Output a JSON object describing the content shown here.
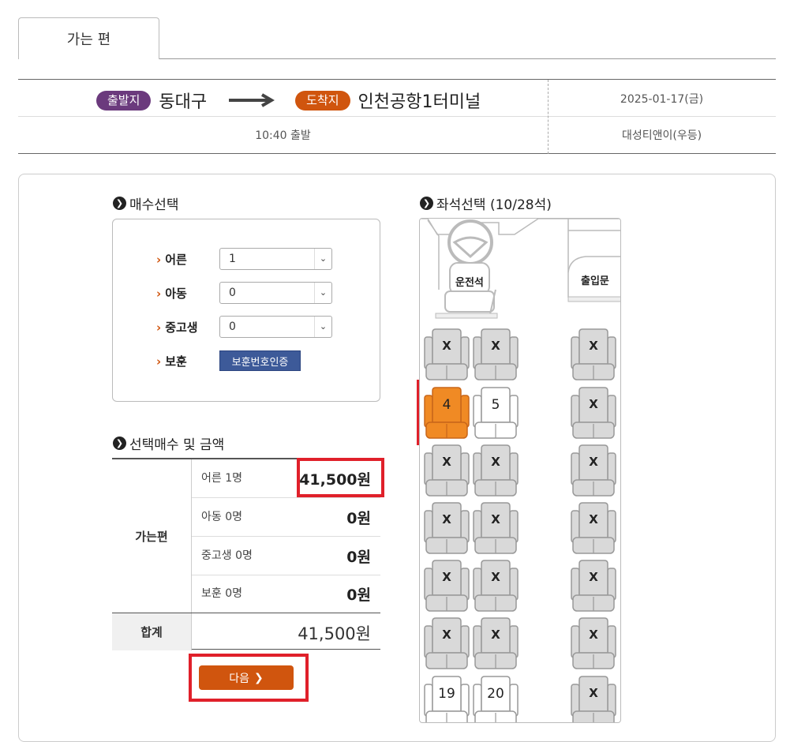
{
  "tab": {
    "label": "가는 편"
  },
  "route": {
    "departure_badge": "출발지",
    "departure_city": "동대구",
    "arrival_badge": "도착지",
    "arrival_city": "인천공항1터미널",
    "date": "2025-01-17(금)",
    "time": "10:40 출발",
    "company": "대성티앤이(우등)"
  },
  "count_section": {
    "title": "매수선택",
    "rows": [
      {
        "label": "어른",
        "value": "1"
      },
      {
        "label": "아동",
        "value": "0"
      },
      {
        "label": "중고생",
        "value": "0"
      },
      {
        "label": "보훈",
        "button": "보훈번호인증"
      }
    ]
  },
  "price_section": {
    "title": "선택매수 및 금액",
    "group": "가는편",
    "rows": [
      {
        "label": "어른 1명",
        "amount": "41,500원"
      },
      {
        "label": "아동 0명",
        "amount": "0원"
      },
      {
        "label": "중고생 0명",
        "amount": "0원"
      },
      {
        "label": "보훈 0명",
        "amount": "0원"
      }
    ],
    "total_label": "합계",
    "total_value": "41,500원",
    "next_button": "다음"
  },
  "seat_section": {
    "title": "좌석선택 (10/28석)",
    "driver_label": "운전석",
    "door_label": "출입문",
    "taken_mark": "X",
    "seats": [
      {
        "label": "X",
        "status": "taken"
      },
      {
        "label": "X",
        "status": "taken"
      },
      {
        "label": "X",
        "status": "taken"
      },
      {
        "label": "4",
        "status": "selected"
      },
      {
        "label": "5",
        "status": "available"
      },
      {
        "label": "X",
        "status": "taken"
      },
      {
        "label": "X",
        "status": "taken"
      },
      {
        "label": "X",
        "status": "taken"
      },
      {
        "label": "X",
        "status": "taken"
      },
      {
        "label": "X",
        "status": "taken"
      },
      {
        "label": "X",
        "status": "taken"
      },
      {
        "label": "X",
        "status": "taken"
      },
      {
        "label": "X",
        "status": "taken"
      },
      {
        "label": "X",
        "status": "taken"
      },
      {
        "label": "X",
        "status": "taken"
      },
      {
        "label": "X",
        "status": "taken"
      },
      {
        "label": "X",
        "status": "taken"
      },
      {
        "label": "X",
        "status": "taken"
      },
      {
        "label": "19",
        "status": "available"
      },
      {
        "label": "20",
        "status": "available"
      },
      {
        "label": "X",
        "status": "taken"
      }
    ]
  },
  "colors": {
    "departure": "#6b3a7d",
    "arrival": "#d0550e",
    "selected_seat": "#f08a24",
    "taken_seat": "#d9d9d9",
    "highlight": "#e0202a",
    "verify_button": "#3d5a99"
  }
}
